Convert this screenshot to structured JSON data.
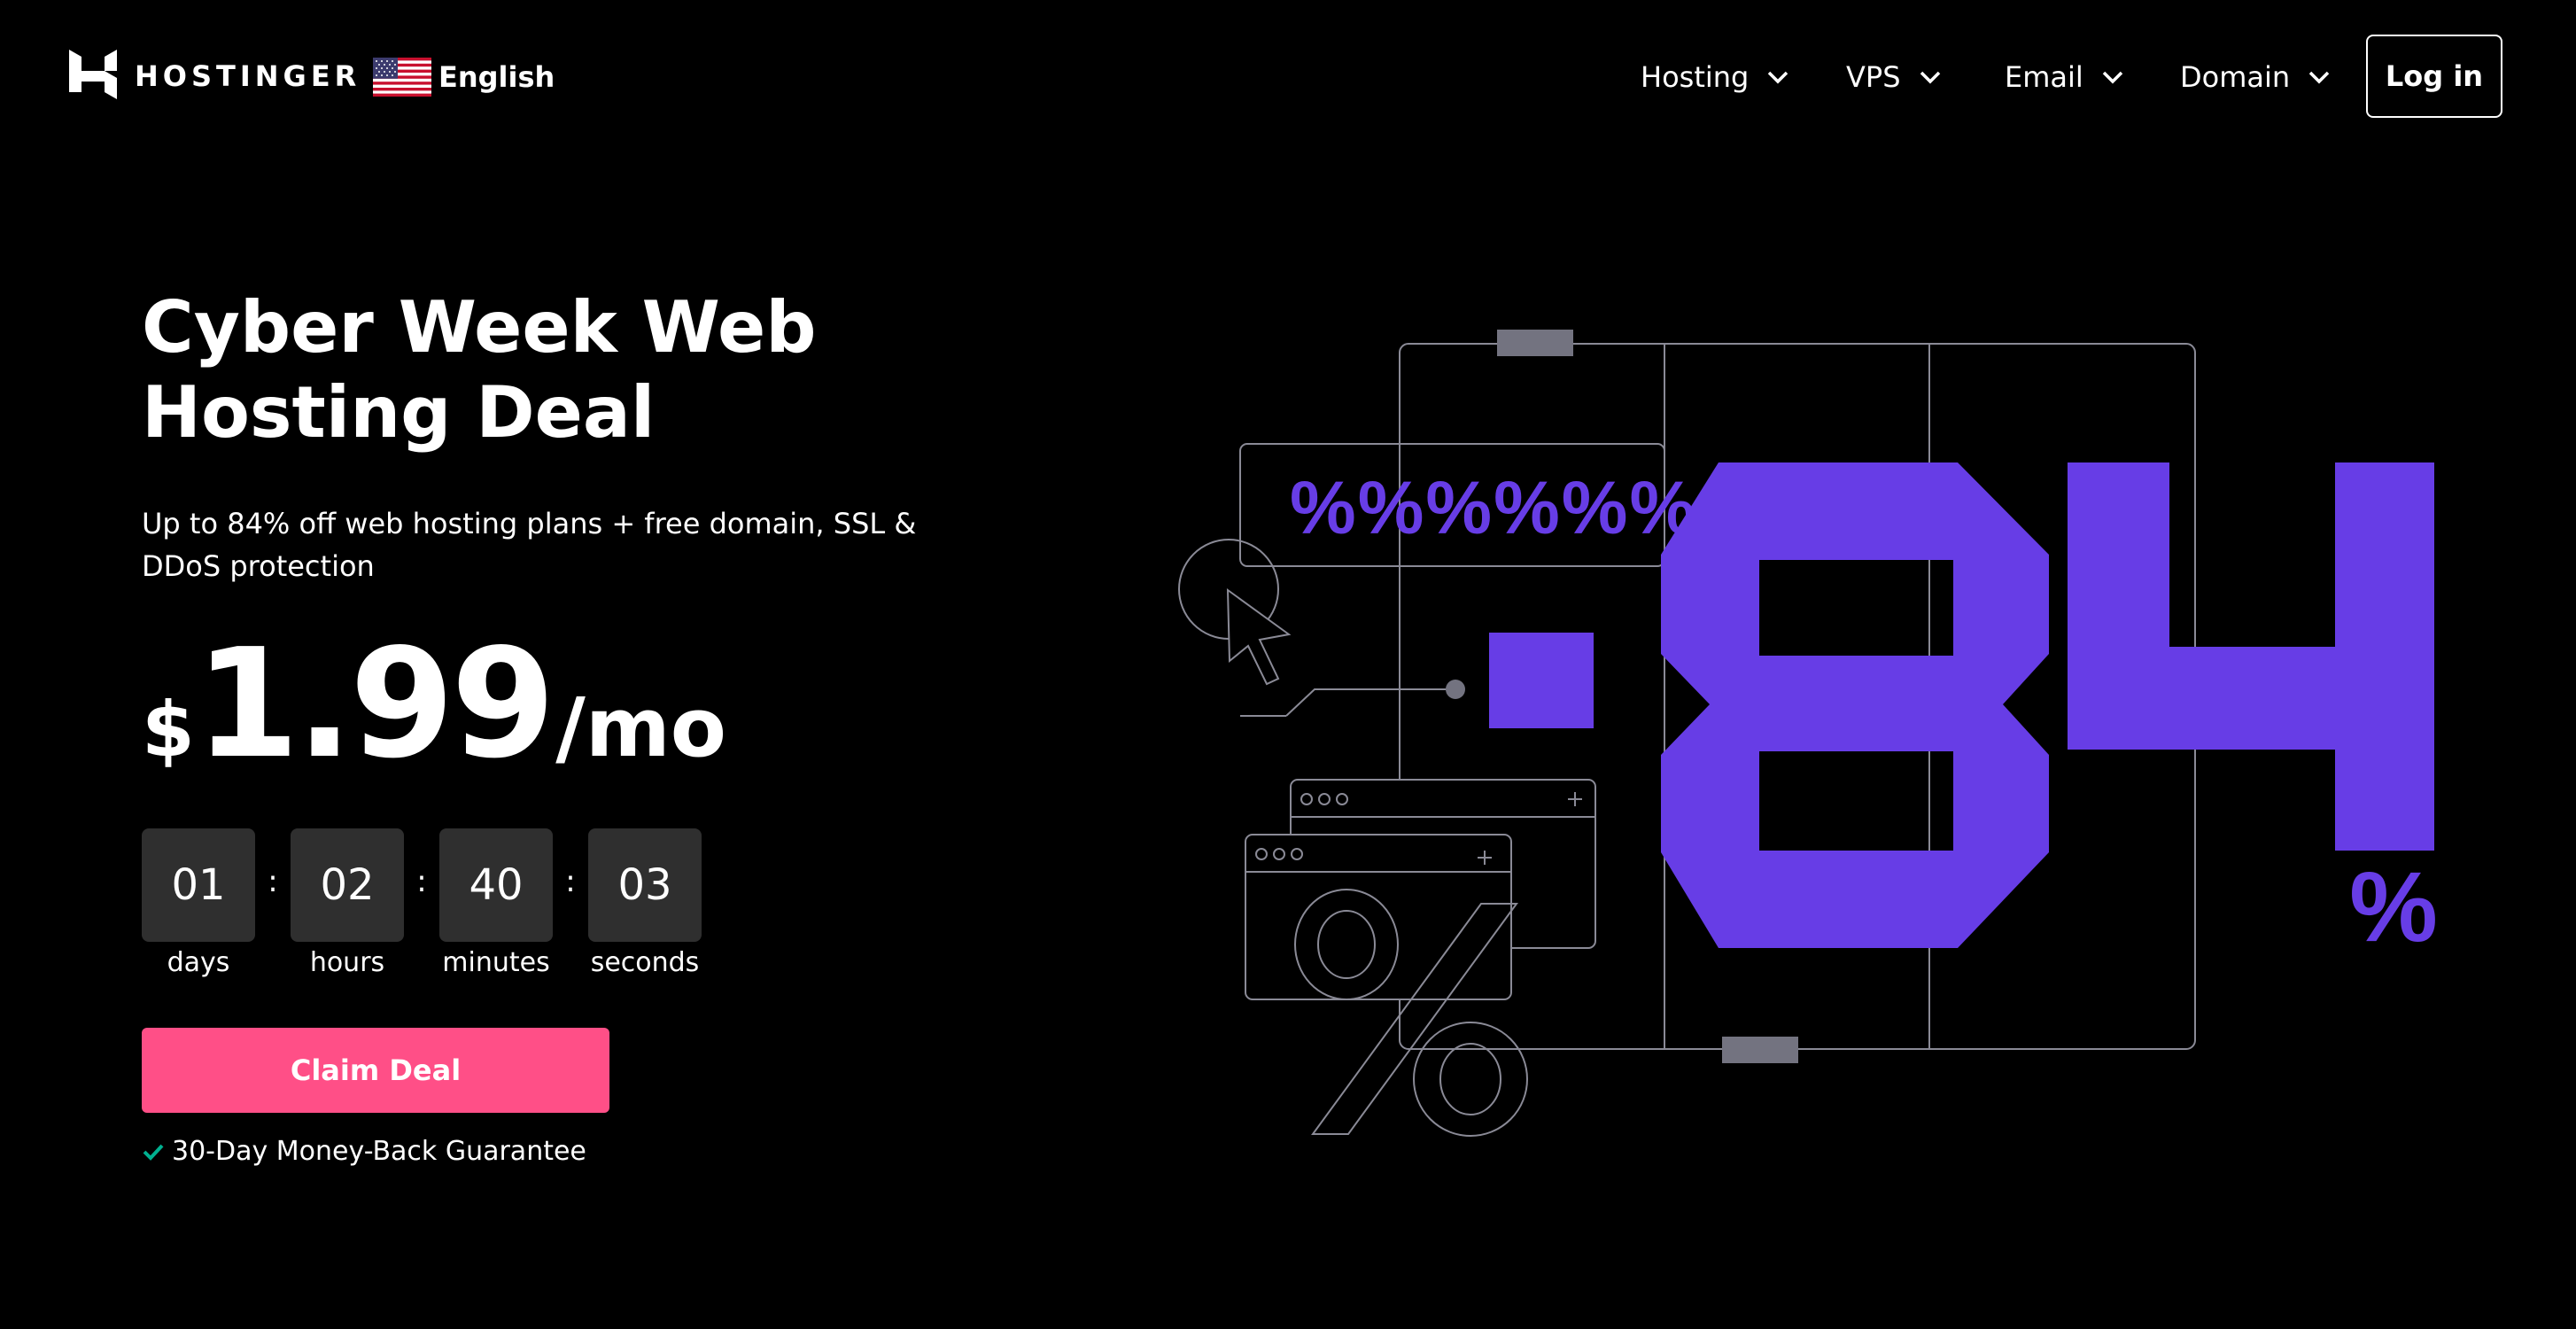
{
  "header": {
    "brand": "HOSTINGER",
    "language": "English",
    "nav": [
      {
        "label": "Hosting"
      },
      {
        "label": "VPS"
      },
      {
        "label": "Email"
      },
      {
        "label": "Domain"
      }
    ],
    "login_label": "Log in"
  },
  "hero": {
    "title_line1": "Cyber Week Web",
    "title_line2": "Hosting Deal",
    "subtitle_line1": "Up to 84% off web hosting plans + free domain, SSL &",
    "subtitle_line2": "DDoS protection",
    "price": {
      "currency": "$",
      "amount": "1.99",
      "period": "/mo"
    },
    "countdown": [
      {
        "value": "01",
        "label": "days"
      },
      {
        "value": "02",
        "label": "hours"
      },
      {
        "value": "40",
        "label": "minutes"
      },
      {
        "value": "03",
        "label": "seconds"
      }
    ],
    "countdown_separator": ":",
    "cta_label": "Claim Deal",
    "guarantee": "30-Day Money-Back Guarantee"
  },
  "illustration": {
    "percent_row": "%%%%%%",
    "big_number": "84",
    "percent_sign": "%"
  },
  "colors": {
    "background": "#000000",
    "accent_purple": "#673de6",
    "cta_pink": "#ff4f87",
    "guarantee_check": "#00b090",
    "countdown_box": "#2f2f2f",
    "line_gray": "#8a8a96"
  },
  "icons": [
    "hostinger-logo-icon",
    "us-flag-icon",
    "chevron-down-icon",
    "check-icon",
    "cursor-arrow-icon"
  ]
}
